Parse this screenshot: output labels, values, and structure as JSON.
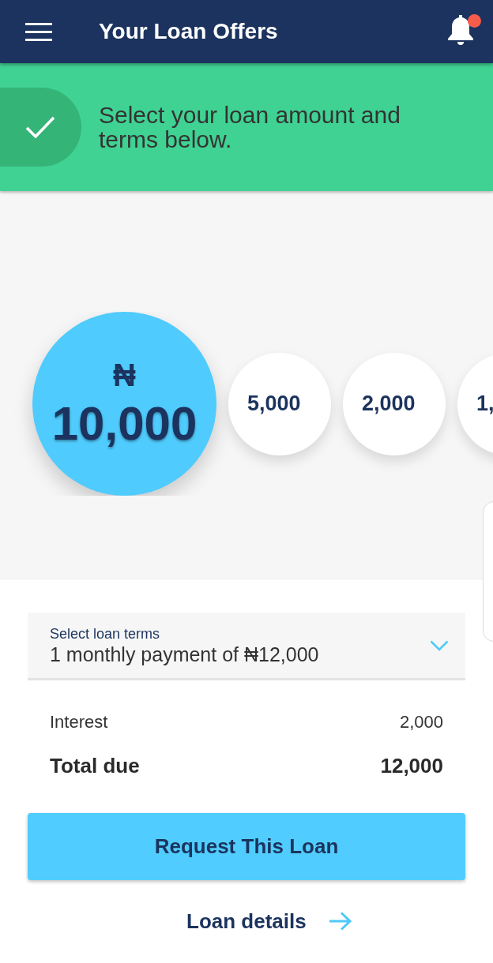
{
  "header": {
    "title": "Your Loan Offers",
    "notifications_unread": true
  },
  "banner": {
    "message": "Select your loan amount and terms below."
  },
  "amounts": {
    "currency": "₦",
    "options": [
      {
        "value": "10,000",
        "selected": true
      },
      {
        "value": "5,000",
        "selected": false
      },
      {
        "value": "2,000",
        "selected": false
      },
      {
        "value": "1,",
        "selected": false
      }
    ]
  },
  "terms": {
    "label": "Select loan terms",
    "value": "1 monthly payment of ₦12,000"
  },
  "summary": [
    {
      "kind": "regular",
      "label": "Interest",
      "value": "2,000"
    },
    {
      "kind": "total",
      "label": "Total due",
      "value": "12,000"
    }
  ],
  "primary_button": "Request This Loan",
  "details_link": "Loan details"
}
